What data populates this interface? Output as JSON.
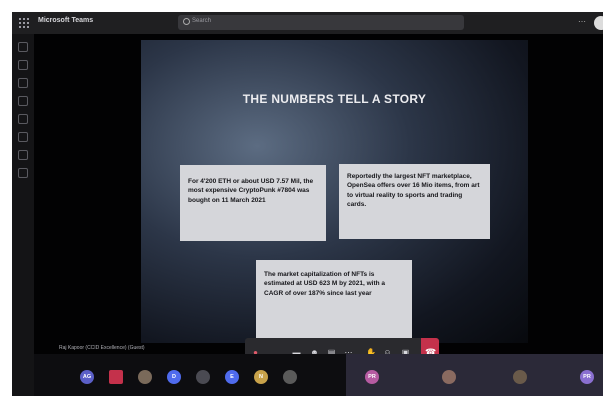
{
  "app": {
    "title": "Microsoft Teams"
  },
  "search": {
    "placeholder": "Search"
  },
  "slide": {
    "title": "THE NUMBERS TELL A STORY",
    "card1": "For 4'200 ETH or about USD 7.57 Mil, the most expensive CryptoPunk #7804 was bought on 11 March 2021",
    "card2": "Reportedly the largest NFT marketplace, OpenSea offers over 16 Mio items, from art to virtual reality to sports and trading cards.",
    "card3": "The market capitalization of NFTs is estimated at USD 623 M by 2021, with a CAGR of over 187% since last year"
  },
  "presenter": {
    "name": "Raj Kapoor (CCID Excellence) (Guest)"
  },
  "participants": [
    {
      "initials": "AG",
      "color": "#5b5fc7"
    },
    {
      "initials": "",
      "color": "#c4314b"
    },
    {
      "initials": "",
      "color": "#7a6a5a"
    },
    {
      "initials": "D",
      "color": "#4f6bed"
    },
    {
      "initials": "",
      "color": "#4a4a52"
    },
    {
      "initials": "E",
      "color": "#4f6bed"
    },
    {
      "initials": "N",
      "color": "#c8a24a"
    },
    {
      "initials": "",
      "color": "#5a5a5a"
    },
    {
      "initials": "PR",
      "color": "#b65ba2"
    },
    {
      "initials": "",
      "color": "#8a6a60"
    },
    {
      "initials": "",
      "color": "#6a5a4a"
    },
    {
      "initials": "PR",
      "color": "#8a6fd0"
    }
  ],
  "colors": {
    "leave": "#c4314b",
    "titlebar": "#1f1f21"
  }
}
